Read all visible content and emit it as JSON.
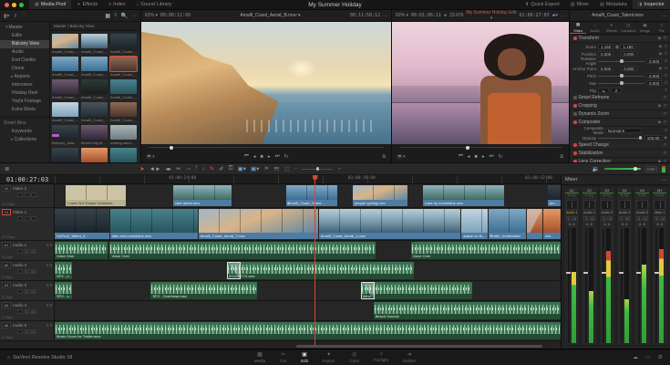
{
  "top_bar": {
    "title": "My Summer Holiday",
    "left_buttons": [
      {
        "label": "Media Pool",
        "icon": "▦",
        "active": true
      },
      {
        "label": "Effects",
        "icon": "✦",
        "active": false
      },
      {
        "label": "Index",
        "icon": "≡",
        "active": false
      },
      {
        "label": "Sound Library",
        "icon": "♪",
        "active": false
      }
    ],
    "right_buttons": [
      {
        "label": "Quick Export",
        "icon": "⬆",
        "active": false
      },
      {
        "label": "Mixer",
        "icon": "▥",
        "active": false
      },
      {
        "label": "Metadata",
        "icon": "▤",
        "active": false
      },
      {
        "label": "Inspector",
        "icon": "◨",
        "active": true
      }
    ]
  },
  "media_pool": {
    "breadcrumb": "Master / Balcony View",
    "bins": [
      {
        "label": "Master",
        "caret": "▾",
        "depth": 0,
        "selected": false
      },
      {
        "label": "Edits",
        "caret": "",
        "depth": 1,
        "selected": false
      },
      {
        "label": "Balcony View",
        "caret": "",
        "depth": 1,
        "selected": true
      },
      {
        "label": "Audio",
        "caret": "",
        "depth": 1,
        "selected": false
      },
      {
        "label": "End Credits",
        "caret": "",
        "depth": 1,
        "selected": false
      },
      {
        "label": "Drone",
        "caret": "",
        "depth": 1,
        "selected": false
      },
      {
        "label": "Airports",
        "caret": "▸",
        "depth": 1,
        "selected": false
      },
      {
        "label": "Interviews",
        "caret": "",
        "depth": 1,
        "selected": false
      },
      {
        "label": "Holiday Reel",
        "caret": "",
        "depth": 1,
        "selected": false
      },
      {
        "label": "Yacht Footage",
        "caret": "",
        "depth": 1,
        "selected": false
      },
      {
        "label": "Extra Shots",
        "caret": "",
        "depth": 1,
        "selected": false
      }
    ],
    "smart_bins_label": "Smart Bins",
    "smart_bins": [
      {
        "label": "Keywords",
        "caret": "",
        "depth": 1,
        "selected": false
      },
      {
        "label": "Collections",
        "caret": "▸",
        "depth": 1,
        "selected": false
      }
    ],
    "clips": [
      {
        "label": "Amalfi_Coast_...",
        "variant": "v-coast",
        "selected": false,
        "tagged": false
      },
      {
        "label": "Amalfi_Coast_...",
        "variant": "v-cliff",
        "selected": false,
        "tagged": false
      },
      {
        "label": "Amalfi_Coast_...",
        "variant": "v-dark",
        "selected": false,
        "tagged": false
      },
      {
        "label": "Amalfi_Coast_...",
        "variant": "v-sea",
        "selected": false,
        "tagged": false
      },
      {
        "label": "Amalfi_Coast_...",
        "variant": "v-sea",
        "selected": false,
        "tagged": false
      },
      {
        "label": "Amalfi_Coast_...",
        "variant": "v-portrait",
        "selected": true,
        "tagged": false
      },
      {
        "label": "Amalfi_Coast_...",
        "variant": "v-dusk",
        "selected": false,
        "tagged": false
      },
      {
        "label": "Amalfi_Coast_...",
        "variant": "v-window",
        "selected": false,
        "tagged": false
      },
      {
        "label": "Amalfi_Coast_...",
        "variant": "v-teal",
        "selected": false,
        "tagged": false
      },
      {
        "label": "Amalfi_Coast_...",
        "variant": "v-sky",
        "selected": false,
        "tagged": false
      },
      {
        "label": "Amalfi_Coast_...",
        "variant": "v-balcony",
        "selected": false,
        "tagged": false
      },
      {
        "label": "Amalfi_Coast_...",
        "variant": "v-portrait",
        "selected": false,
        "tagged": false
      },
      {
        "label": "Balcony_deta...",
        "variant": "v-dark",
        "selected": false,
        "tagged": true
      },
      {
        "label": "Behind big te...",
        "variant": "v-dusk",
        "selected": false,
        "tagged": false
      },
      {
        "label": "making sand...",
        "variant": "v-mist",
        "selected": false,
        "tagged": false
      },
      {
        "label": "",
        "variant": "v-dark",
        "selected": false,
        "tagged": false
      },
      {
        "label": "",
        "variant": "v-sunset",
        "selected": false,
        "tagged": false
      },
      {
        "label": "",
        "variant": "v-teal",
        "selected": false,
        "tagged": false
      }
    ]
  },
  "source_viewer": {
    "zoom": "62%",
    "left_timecode": "00:00:11:09",
    "clip_name": "Amalfi_Coast_Aerial_B.mov",
    "right_timecode": "00:11:58:12",
    "more": "…"
  },
  "timeline_viewer": {
    "zoom": "62%",
    "duration_timecode": "00:01:06:11",
    "fps_dot": "●",
    "fps": "23.976",
    "timeline_name": "My Summer Holiday Edit",
    "playhead_timecode": "01:00:27:03",
    "more": "…"
  },
  "transport": {
    "first": "⏮",
    "back": "◂",
    "stop": "■",
    "play": "▸",
    "last": "⏭",
    "loop": "↻",
    "left_icon": "⬒",
    "in_out": "⧉"
  },
  "inspector": {
    "clip_name": "Amalfi_Coast_Talent.mov",
    "more": "…",
    "tabs": [
      {
        "label": "Video",
        "icon": "▦",
        "active": true
      },
      {
        "label": "Audio",
        "icon": "♪",
        "active": false
      },
      {
        "label": "Effects",
        "icon": "✦",
        "active": false
      },
      {
        "label": "Transition",
        "icon": "◫",
        "active": false
      },
      {
        "label": "Image",
        "icon": "▣",
        "active": false
      },
      {
        "label": "File",
        "icon": "≡",
        "active": false
      }
    ],
    "transform": {
      "title": "Transform",
      "keyframe_icon": "◆",
      "reset_icon": "↺",
      "zoom_label": "Zoom",
      "zoom_x": "1.150",
      "zoom_y": "1.150",
      "link_icon": "⧉",
      "position_label": "Position",
      "position_x": "0.000",
      "position_y": "0.000",
      "rotation_label": "Rotation Angle",
      "rotation_value": "0.000",
      "anchor_label": "Anchor Point",
      "anchor_x": "0.000",
      "anchor_y": "0.000",
      "pitch_label": "Pitch",
      "pitch_value": "0.000",
      "yaw_label": "Yaw",
      "yaw_value": "0.000",
      "flip_label": "Flip",
      "flip_h": "⇋",
      "flip_v": "⇵"
    },
    "composite": {
      "mode_label": "Composite Mode",
      "mode_value": "Normal",
      "opacity_label": "Opacity",
      "opacity_value": "100.00"
    },
    "sections": [
      {
        "title": "Smart Reframe",
        "enabled": false
      },
      {
        "title": "Cropping",
        "enabled": true
      },
      {
        "title": "Dynamic Zoom",
        "enabled": false
      },
      {
        "title": "Speed Change",
        "enabled": true
      },
      {
        "title": "Stabilization",
        "enabled": true
      },
      {
        "title": "Lens Correction",
        "enabled": true
      }
    ],
    "composite_title": "Composite"
  },
  "toolbar": {
    "timeline_options_icon": "≣",
    "tools": [
      {
        "icon": "➤",
        "name": "selection-mode",
        "state": "red"
      },
      {
        "icon": "◄►",
        "name": "trim-edit-mode",
        "state": ""
      },
      {
        "icon": "◂▸",
        "name": "dynamic-trim-mode",
        "state": ""
      },
      {
        "icon": "✂",
        "name": "razor-edit-mode",
        "state": ""
      },
      {
        "icon": "⇥",
        "name": "insert-clip",
        "state": "dim"
      },
      {
        "icon": "⤒",
        "name": "overwrite-clip",
        "state": "dim"
      },
      {
        "icon": "⤓",
        "name": "replace-clip",
        "state": "dim"
      },
      {
        "icon": "✎",
        "name": "pen-tool",
        "state": "red"
      },
      {
        "icon": "✐",
        "name": "brush-tool",
        "state": ""
      },
      {
        "icon": "⚿",
        "name": "lock-tool",
        "state": ""
      },
      {
        "icon": "▣▾",
        "name": "snapping-toggle",
        "state": "blue"
      },
      {
        "icon": "▣▾",
        "name": "linked-selection-toggle",
        "state": "blue"
      },
      {
        "icon": "⚑",
        "name": "flag-marker",
        "state": "dim"
      },
      {
        "icon": "⬒",
        "name": "add-marker",
        "state": "dim"
      },
      {
        "icon": "◫",
        "name": "marker-color",
        "state": "dim"
      }
    ],
    "zoom_minus": "−",
    "zoom_plus": "+",
    "speaker_icon": "🔉",
    "dim_label": "DIM"
  },
  "timeline": {
    "playhead_timecode": "01:00:27:03",
    "ruler_labels": [
      {
        "text": "01:00:24:00",
        "left": "22.6%"
      },
      {
        "text": "01:00:28:00",
        "left": "58%"
      },
      {
        "text": "01:00:32:00",
        "left": "93%"
      }
    ],
    "video_tracks": [
      {
        "id": "V2",
        "name": "Video 2",
        "count": "11 Clips",
        "selected": false,
        "clips": [
          {
            "name": "Lower 3rd Simple Underline",
            "left": "2.2%",
            "width": "11.8%",
            "variant": "v-title",
            "title": true
          },
          {
            "name": "lake aerial.mov",
            "left": "23.5%",
            "width": "11.4%",
            "variant": "v-lake"
          },
          {
            "name": "Amalfi_Coast_Talent...",
            "left": "45.7%",
            "width": "10.1%",
            "variant": "v-sea",
            "fx": true
          },
          {
            "name": "people cycling.mov",
            "left": "58.9%",
            "width": "10.9%",
            "variant": "v-coast"
          },
          {
            "name": "Lake by mountains.mov",
            "left": "72.8%",
            "width": "16%",
            "variant": "v-lake"
          },
          {
            "name": "Am...",
            "left": "97.4%",
            "width": "2.6%",
            "variant": "v-dark"
          }
        ]
      },
      {
        "id": "V1",
        "name": "Video 1",
        "count": "17 Clips",
        "selected": true,
        "clips": [
          {
            "name": "GoPro4_Talent_3...",
            "left": "0%",
            "width": "10.9%",
            "variant": "v-dark"
          },
          {
            "name": "lake and mountains.mov",
            "left": "11%",
            "width": "17.2%",
            "variant": "v-teal"
          },
          {
            "name": "Amalfi_Coast_Aerial_7.mov",
            "left": "28.4%",
            "width": "23.6%",
            "variant": "v-coast"
          },
          {
            "name": "Amalfi_Coast_Aerial_1.mov",
            "left": "52.2%",
            "width": "28%",
            "variant": "v-cliff"
          },
          {
            "name": "statue on th...",
            "left": "80.4%",
            "width": "5.2%",
            "variant": "v-sky"
          },
          {
            "name": "Turtle_Underwater",
            "left": "85.8%",
            "width": "7.4%",
            "variant": "v-sea",
            "fx": true
          },
          {
            "name": "",
            "left": "93.4%",
            "width": "3%",
            "variant": "v-sunset",
            "transition": true
          },
          {
            "name": "Am...",
            "left": "96.6%",
            "width": "3.4%",
            "variant": "v-sunset"
          }
        ]
      }
    ],
    "audio_tracks": [
      {
        "id": "A1",
        "name": "Audio 1",
        "fmt": "2.0",
        "count": "9 Clips",
        "clips": [
          {
            "name": "Voice Over",
            "left": "0%",
            "width": "10.5%"
          },
          {
            "name": "Voice Over",
            "left": "10.9%",
            "width": "52.5%"
          },
          {
            "name": "Voice Over",
            "left": "70.4%",
            "width": "29.6%"
          }
        ]
      },
      {
        "id": "A2",
        "name": "Audio 2",
        "fmt": "2.0",
        "count": "5 Clips",
        "clips": [
          {
            "name": "SFX - p...",
            "left": "0%",
            "width": "3.4%"
          },
          {
            "name": "SOUND FX.wav",
            "left": "34%",
            "width": "37%",
            "fade": true
          }
        ]
      },
      {
        "id": "A3",
        "name": "Audio 3",
        "fmt": "2.0",
        "count": "5 Clips",
        "clips": [
          {
            "name": "SFX - s...",
            "left": "0%",
            "width": "3.4%"
          },
          {
            "name": "SFX - Overhead.mov",
            "left": "19%",
            "width": "21%"
          },
          {
            "name": "Wind",
            "left": "60.5%",
            "width": "22%",
            "fade": true
          }
        ]
      },
      {
        "id": "A4",
        "name": "Audio 4",
        "fmt": "2.0",
        "count": "3 Clips",
        "clips": [
          {
            "name": "Beach Sounds",
            "left": "63%",
            "width": "37%"
          }
        ]
      },
      {
        "id": "A5",
        "name": "Audio 5",
        "fmt": "2.0",
        "count": "2 Clips",
        "clips": [
          {
            "name": "Music Score for Trailer.mov",
            "left": "0%",
            "width": "100%"
          }
        ]
      }
    ]
  },
  "mixer": {
    "title": "Mixer",
    "more": "…",
    "fx_label": "fx",
    "eq_label": "EQ",
    "solo_label": "S",
    "mute_label": "M",
    "channels": [
      {
        "id": "A1",
        "name": "Audio 1",
        "db": "0.0",
        "level": "62%",
        "peak_class": "peak-yellow",
        "selected": true,
        "has_sm": true
      },
      {
        "id": "A2",
        "name": "Audio 2",
        "db": "0.0",
        "level": "45%",
        "peak_class": "",
        "selected": false,
        "has_sm": true
      },
      {
        "id": "A3",
        "name": "Audio 3",
        "db": "0.0",
        "level": "80%",
        "peak_class": "peak-red",
        "selected": false,
        "has_sm": true
      },
      {
        "id": "A4",
        "name": "Audio 4",
        "db": "0.0",
        "level": "38%",
        "peak_class": "",
        "selected": false,
        "has_sm": true
      },
      {
        "id": "A5",
        "name": "Audio 5",
        "db": "0.0",
        "level": "68%",
        "peak_class": "",
        "selected": false,
        "has_sm": true
      },
      {
        "id": "M1",
        "name": "Main 1",
        "db": "0.0",
        "level": "82%",
        "peak_class": "peak-red",
        "selected": false,
        "has_sm": false
      }
    ]
  },
  "bottom_bar": {
    "app_name": "DaVinci Resolve Studio 18",
    "pages": [
      {
        "label": "Media",
        "icon": "▦",
        "active": false
      },
      {
        "label": "Cut",
        "icon": "✂",
        "active": false
      },
      {
        "label": "Edit",
        "icon": "▣",
        "active": true
      },
      {
        "label": "Fusion",
        "icon": "✦",
        "active": false
      },
      {
        "label": "Color",
        "icon": "◎",
        "active": false
      },
      {
        "label": "Fairlight",
        "icon": "♫",
        "active": false
      },
      {
        "label": "Deliver",
        "icon": "➔",
        "active": false
      }
    ],
    "right_icons": [
      {
        "icon": "☁",
        "name": "cloud-icon"
      },
      {
        "icon": "▭",
        "name": "remote-monitoring-icon"
      },
      {
        "icon": "⚙",
        "name": "settings-gear-icon"
      }
    ]
  }
}
